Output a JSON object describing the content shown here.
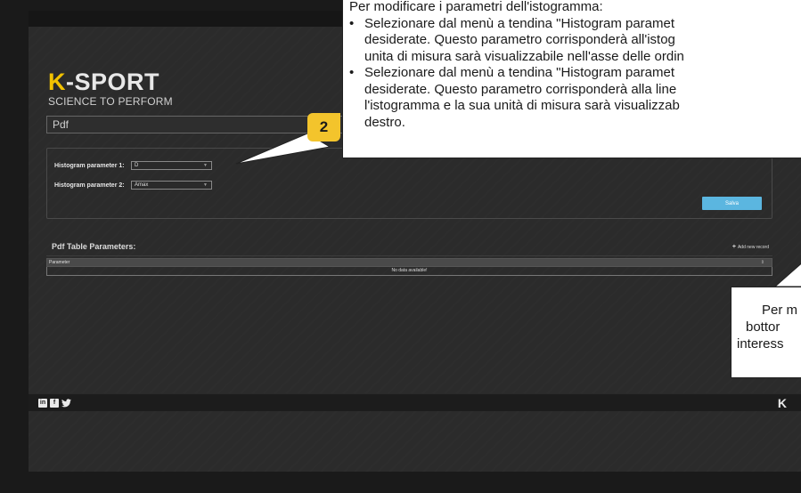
{
  "brand": {
    "logo_prefix": "K",
    "logo_name": "-SPORT",
    "tagline": "SCIENCE TO PERFORM"
  },
  "page": {
    "title": "Pdf"
  },
  "settings": {
    "param1_label": "Histogram parameter 1:",
    "param1_value": "D",
    "param2_label": "Histogram parameter 2:",
    "param2_value": "Amax",
    "save_label": "Salva"
  },
  "table": {
    "title": "Pdf Table Parameters:",
    "add_label": "Add new record",
    "columns": [
      "Parameter"
    ],
    "empty_text": "No data available!"
  },
  "footer": {
    "social": [
      "linkedin-icon",
      "facebook-icon",
      "twitter-icon"
    ],
    "social_text": [
      "in",
      "f",
      "❧"
    ],
    "logo": "K"
  },
  "callouts": {
    "main_line0": "Per modificare i parametri dell'istogramma:",
    "main_b1_l1": "Selezionare dal menù a tendina \"Histogram paramet",
    "main_b1_l2": "desiderate. Questo parametro corrisponderà all'istog",
    "main_b1_l3": "unita di misura sarà visualizzabile nell'asse delle ordin",
    "main_b2_l1": "Selezionare dal menù a tendina \"Histogram paramet",
    "main_b2_l2": "desiderate. Questo parametro corrisponderà alla line",
    "main_b2_l3": "l'istogramma e la sua unità di misura sarà visualizzab",
    "main_b2_l4": "destro.",
    "bullet": "•",
    "badge_number": "2",
    "side_l1": "Per m",
    "side_l2": "bottor",
    "side_l3": "interess"
  },
  "colors": {
    "accent": "#f3c42c",
    "save_button": "#5bb6e0",
    "background": "#2b2b2b"
  }
}
